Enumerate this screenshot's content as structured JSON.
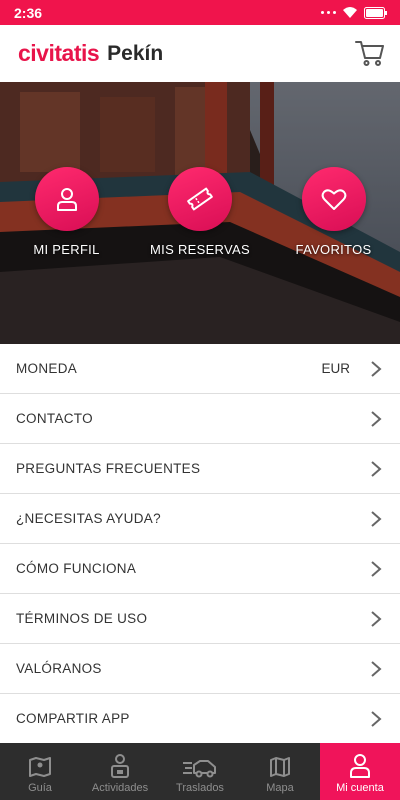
{
  "status_bar": {
    "time": "2:36"
  },
  "header": {
    "brand": "civitatis",
    "city": "Pekín"
  },
  "hero": {
    "actions": [
      {
        "label": "MI PERFIL",
        "icon": "person-icon"
      },
      {
        "label": "MIS RESERVAS",
        "icon": "ticket-icon"
      },
      {
        "label": "FAVORITOS",
        "icon": "heart-icon"
      }
    ]
  },
  "menu": {
    "items": [
      {
        "label": "MONEDA",
        "value": "EUR"
      },
      {
        "label": "CONTACTO"
      },
      {
        "label": "PREGUNTAS FRECUENTES"
      },
      {
        "label": "¿NECESITAS AYUDA?"
      },
      {
        "label": "CÓMO FUNCIONA"
      },
      {
        "label": "TÉRMINOS DE USO"
      },
      {
        "label": "VALÓRANOS"
      },
      {
        "label": "COMPARTIR APP"
      }
    ]
  },
  "bottom_nav": {
    "items": [
      {
        "label": "Guía",
        "icon": "map-pin-icon"
      },
      {
        "label": "Actividades",
        "icon": "activities-icon"
      },
      {
        "label": "Traslados",
        "icon": "car-icon"
      },
      {
        "label": "Mapa",
        "icon": "map-icon"
      },
      {
        "label": "Mi cuenta",
        "icon": "person-icon",
        "active": true
      }
    ]
  },
  "colors": {
    "accent": "#f0144c",
    "nav_bg": "#2d2d2d"
  }
}
